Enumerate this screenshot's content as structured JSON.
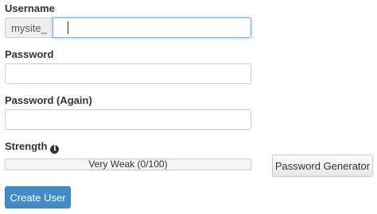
{
  "username": {
    "label": "Username",
    "prefix": "mysite_",
    "value": ""
  },
  "password": {
    "label": "Password",
    "value": ""
  },
  "password_again": {
    "label": "Password (Again)",
    "value": ""
  },
  "strength": {
    "label": "Strength",
    "icon": "info-icon",
    "text": "Very Weak (0/100)",
    "score": 0,
    "max": 100
  },
  "buttons": {
    "generator_label": "Password Generator",
    "create_label": "Create User"
  },
  "colors": {
    "primary": "#428bca",
    "focus_border": "#66afe9",
    "addon_bg": "#eeeeee"
  }
}
